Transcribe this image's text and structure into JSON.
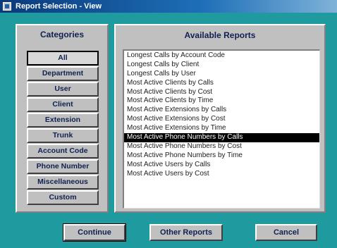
{
  "window": {
    "title": "Report Selection - View"
  },
  "categories": {
    "title": "Categories",
    "items": [
      {
        "label": "All",
        "active": true
      },
      {
        "label": "Department"
      },
      {
        "label": "User"
      },
      {
        "label": "Client"
      },
      {
        "label": "Extension"
      },
      {
        "label": "Trunk"
      },
      {
        "label": "Account Code"
      },
      {
        "label": "Phone Number"
      },
      {
        "label": "Miscellaneous"
      },
      {
        "label": "Custom"
      }
    ]
  },
  "reports": {
    "title": "Available Reports",
    "items": [
      "Longest Calls by Account Code",
      "Longest Calls by Client",
      "Longest Calls by User",
      "Most Active Clients by Calls",
      "Most Active Clients by Cost",
      "Most Active Clients by Time",
      "Most Active Extensions by Calls",
      "Most Active Extensions by Cost",
      "Most Active Extensions by Time",
      "Most Active Phone Numbers by Calls",
      "Most Active Phone Numbers by Cost",
      "Most Active Phone Numbers by Time",
      "Most Active Users by Calls",
      "Most Active Users by Cost"
    ],
    "selected": "Most Active Phone Numbers by Calls"
  },
  "buttons": {
    "continue": "Continue",
    "other_reports": "Other Reports",
    "cancel": "Cancel"
  },
  "colors": {
    "background": "#1f9a9e",
    "panel": "#c0c0c0",
    "selection": "#000000"
  }
}
